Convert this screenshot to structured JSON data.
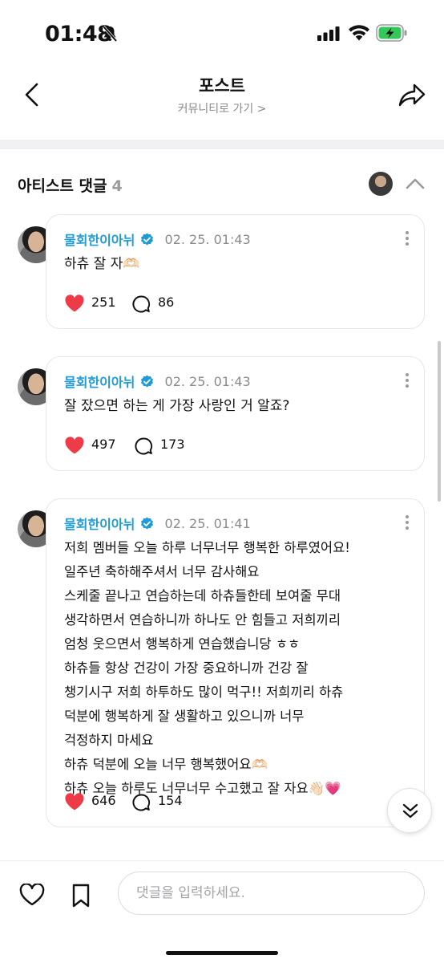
{
  "status_bar": {
    "time": "01:48"
  },
  "header": {
    "title": "포스트",
    "community_link": "커뮤니티로 가기 >"
  },
  "section": {
    "title": "아티스트 댓글",
    "count": "4"
  },
  "comments": [
    {
      "author": "물회한이아뉘",
      "date": "02. 25. 01:43",
      "text": "하츄 잘 자🫶🏻",
      "likes": "251",
      "replies": "86"
    },
    {
      "author": "물회한이아뉘",
      "date": "02. 25. 01:43",
      "text": "잘 잤으면 하는 게 가장 사랑인 거 알죠?",
      "likes": "497",
      "replies": "173"
    },
    {
      "author": "물회한이아뉘",
      "date": "02. 25. 01:41",
      "text": "저희 멤버들 오늘 하루 너무너무 행복한 하루였어요!\n일주년 축하해주셔서 너무 감사해요\n스케줄 끝나고 연습하는데 하츄들한테 보여줄 무대\n생각하면서 연습하니까 하나도 안 힘들고 저희끼리\n엄청 웃으면서 행복하게 연습했습니당 ㅎㅎ\n하츄들 항상 건강이 가장 중요하니까 건강 잘\n챙기시구 저희 하투하도 많이 먹구!! 저희끼리 하츄\n덕분에 행복하게 잘 생활하고 있으니까 너무\n걱정하지 마세요\n하츄 덕분에 오늘 너무 행복했어요🫶🏻\n하츄 오늘 하루도 너무너무 수고했고 잘 자요👋🏻💗",
      "likes": "646",
      "replies": "154"
    }
  ],
  "input": {
    "placeholder": "댓글을 입력하세요."
  },
  "colors": {
    "accent": "#1e9bd7",
    "like": "#ef3b47",
    "battery": "#34c759"
  },
  "icons": [
    "bell-slash-icon",
    "signal-icon",
    "wifi-icon",
    "battery-icon",
    "back-icon",
    "share-icon",
    "chevron-up-icon",
    "verified-icon",
    "more-vertical-icon",
    "heart-filled-icon",
    "reply-icon",
    "double-chevron-down-icon",
    "heart-outline-icon",
    "bookmark-icon"
  ]
}
